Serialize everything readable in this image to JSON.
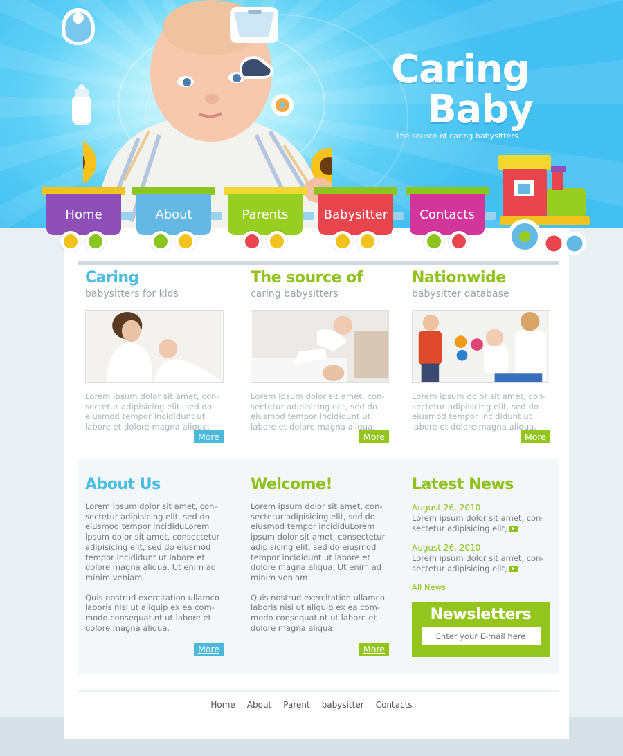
{
  "logo": {
    "line1": "Caring",
    "line2": "Baby",
    "tagline": "The source of caring babysitters"
  },
  "nav": {
    "items": [
      {
        "label": "Home",
        "color": "#8e4fb9"
      },
      {
        "label": "About",
        "color": "#64b9e4"
      },
      {
        "label": "Parents",
        "color": "#98cd22"
      },
      {
        "label": "Babysitter",
        "color": "#e8454f"
      },
      {
        "label": "Contacts",
        "color": "#d2369b"
      }
    ]
  },
  "features": [
    {
      "title": "Caring",
      "subtitle": "babysitters for kids",
      "text": "Lorem ipsum dolor sit amet, con-sectetur adipisicing elit, sed do eiusmod tempor incididunt ut labore et dolore magna aliqua.",
      "more": "More"
    },
    {
      "title": "The source of",
      "subtitle": "caring babysitters",
      "text": "Lorem ipsum dolor sit amet, con-sectetur adipisicing elit, sed do eiusmod tempor incididunt ut labore et dolore magna aliqua.",
      "more": "More"
    },
    {
      "title": "Nationwide",
      "subtitle": "babysitter database",
      "text": "Lorem ipsum dolor sit amet, con-sectetur adipisicing elit, sed do eiusmod tempor incididunt ut labore et dolore magna aliqua.",
      "more": "More"
    }
  ],
  "about": {
    "title": "About Us",
    "p1": "Lorem ipsum dolor sit amet, con-sectetur adipisicing elit, sed do eiusmod tempor incididuLorem ipsum dolor sit amet, consectetur adipisicing elit, sed do eiusmod tempor incididunt ut labore et dolore magna aliqua. Ut enim ad minim veniam.",
    "p2": "Quis nostrud exercitation ullamco laboris nisi ut aliquip ex ea com-modo consequat.nt ut labore et dolore magna aliqua.",
    "more": "More"
  },
  "welcome": {
    "title": "Welcome!",
    "p1": "Lorem ipsum dolor sit amet, con-sectetur adipisicing elit, sed do eiusmod tempor incididuLorem ipsum dolor sit amet, consectetur adipisicing elit, sed do eiusmod tempor incididunt ut labore et dolore magna aliqua. Ut enim ad minim veniam.",
    "p2": "Quis nostrud exercitation ullamco laboris nisi ut aliquip ex ea com-modo consequat.nt ut labore et dolore magna aliqua.",
    "more": "More"
  },
  "news": {
    "title": "Latest News",
    "items": [
      {
        "date": "August 26, 2010",
        "text": "Lorem ipsum dolor sit amet, con-sectetur adipisicing elit,"
      },
      {
        "date": "August 26, 2010",
        "text": "Lorem ipsum dolor sit amet, con-sectetur adipisicing elit,"
      }
    ],
    "all_link": "All News"
  },
  "newsletter": {
    "title": "Newsletters",
    "placeholder": "Enter your E-mail here"
  },
  "footer": {
    "links": [
      "Home",
      "About",
      "Parent",
      "babysitter",
      "Contacts"
    ]
  },
  "colors": {
    "blue": "#4ab9da",
    "green": "#94c51d",
    "sky": "#42c0f2"
  }
}
